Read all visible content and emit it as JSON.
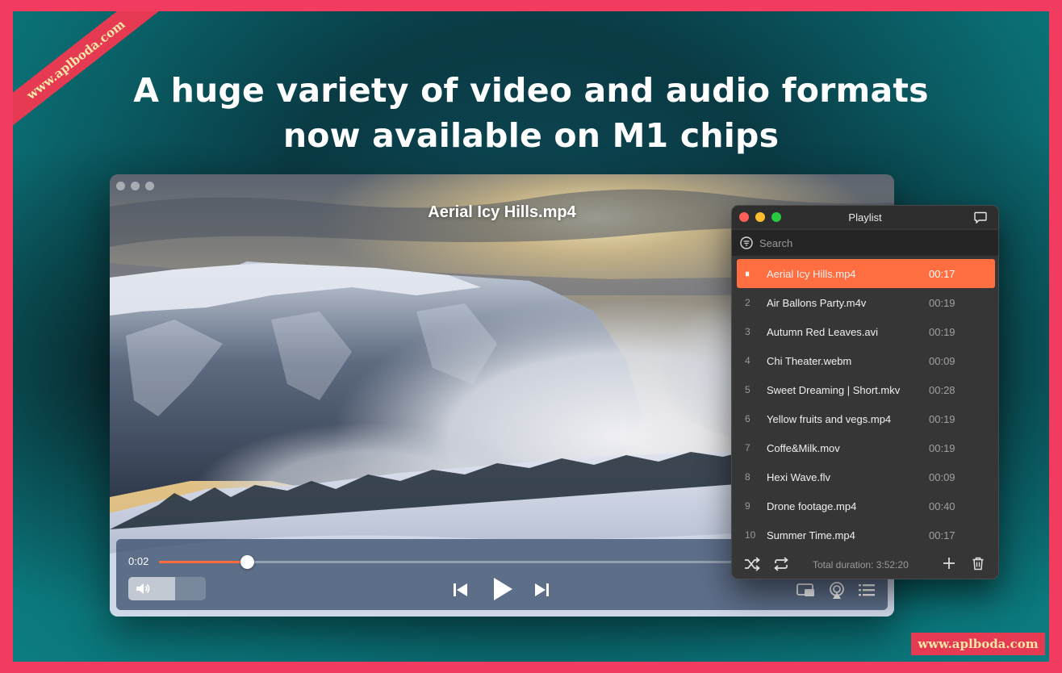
{
  "headline": {
    "line1": "A huge variety of video and audio formats",
    "line2": "now available on M1 chips"
  },
  "watermarks": {
    "ribbon": "www.aplboda.com",
    "corner": "www.aplboda.com"
  },
  "player": {
    "title": "Aerial Icy Hills.mp4",
    "current_time": "0:02",
    "progress_fraction": 0.143,
    "volume_fraction": 0.6,
    "icons": {
      "volume": "speaker-icon",
      "prev": "skip-back-icon",
      "play": "play-icon",
      "next": "skip-forward-icon",
      "pip": "picture-in-picture-icon",
      "airplay": "airplay-icon",
      "playlist": "playlist-icon"
    }
  },
  "playlist": {
    "title": "Playlist",
    "search_placeholder": "Search",
    "items": [
      {
        "num": "⏸",
        "name": "Aerial Icy Hills.mp4",
        "duration": "00:17",
        "active": true
      },
      {
        "num": "2",
        "name": "Air Ballons Party.m4v",
        "duration": "00:19"
      },
      {
        "num": "3",
        "name": "Autumn Red Leaves.avi",
        "duration": "00:19"
      },
      {
        "num": "4",
        "name": "Chi Theater.webm",
        "duration": "00:09"
      },
      {
        "num": "5",
        "name": "Sweet Dreaming | Short.mkv",
        "duration": "00:28"
      },
      {
        "num": "6",
        "name": "Yellow fruits and vegs.mp4",
        "duration": "00:19"
      },
      {
        "num": "7",
        "name": "Coffe&Milk.mov",
        "duration": "00:19"
      },
      {
        "num": "8",
        "name": "Hexi Wave.flv",
        "duration": "00:09"
      },
      {
        "num": "9",
        "name": "Drone footage.mp4",
        "duration": "00:40"
      },
      {
        "num": "10",
        "name": "Summer Time.mp4",
        "duration": "00:17"
      }
    ],
    "total_duration": "Total duration: 3:52:20",
    "colors": {
      "accent": "#ff6e40",
      "close": "#ff5f57",
      "minimize": "#febc2e",
      "zoom": "#28c840"
    }
  }
}
